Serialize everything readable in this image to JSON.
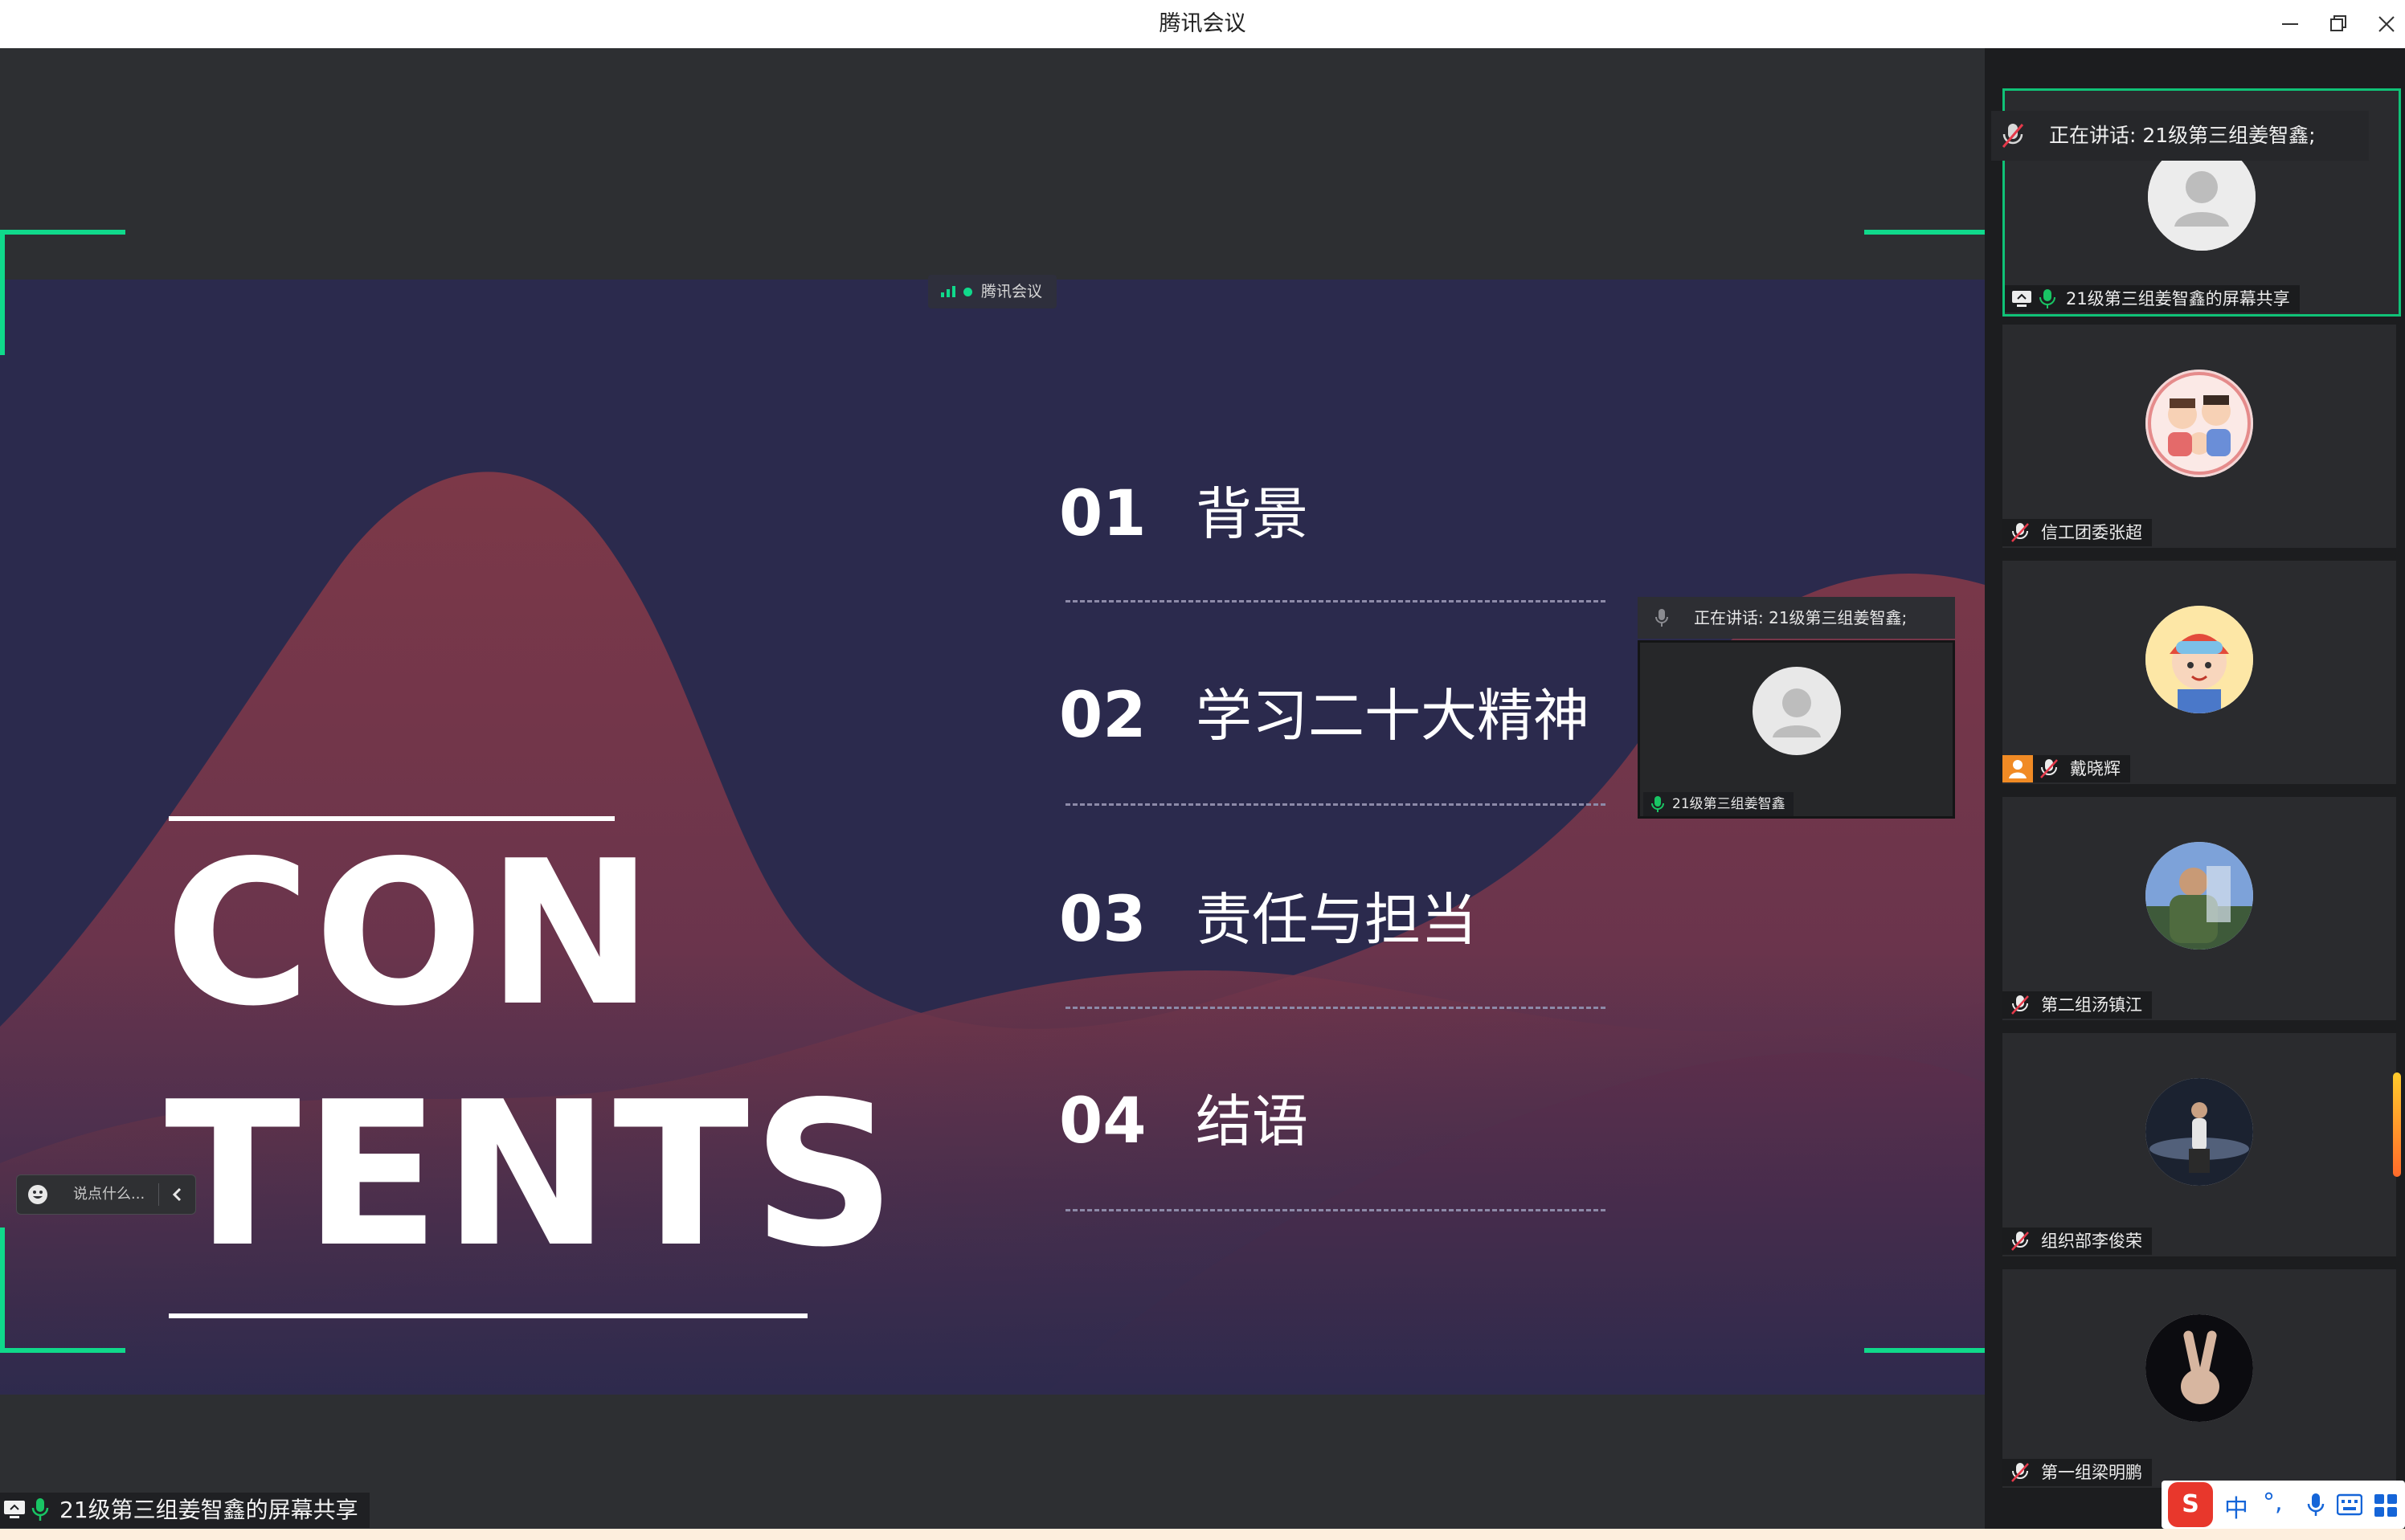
{
  "window": {
    "title": "腾讯会议"
  },
  "slide": {
    "tag": "腾讯会议",
    "contents_line1": "CON",
    "contents_line2": "TENTS",
    "toc": [
      {
        "num": "01",
        "text": "背景"
      },
      {
        "num": "02",
        "text": "学习二十大精神"
      },
      {
        "num": "03",
        "text": "责任与担当"
      },
      {
        "num": "04",
        "text": "结语"
      }
    ],
    "mini_speaking": "正在讲话: 21级第三组姜智鑫;",
    "mini_name": "21级第三组姜智鑫"
  },
  "chat": {
    "placeholder": "说点什么..."
  },
  "share_label": "21级第三组姜智鑫的屏幕共享",
  "panel": {
    "speaking": "正在讲话: 21级第三组姜智鑫;",
    "participants": [
      {
        "name": "21级第三组姜智鑫的屏幕共享",
        "avatar": "default-person"
      },
      {
        "name": "信工团委张超",
        "avatar": "cartoon-family"
      },
      {
        "name": "戴晓辉",
        "avatar": "cartoon-girl"
      },
      {
        "name": "第二组汤镇江",
        "avatar": "photo-person"
      },
      {
        "name": "组织部李俊荣",
        "avatar": "photo-figure"
      },
      {
        "name": "第一组梁明鹏",
        "avatar": "photo-peace-sign"
      }
    ]
  },
  "ime": {
    "logo": "S",
    "lang": "中",
    "punct": "°,",
    "icons": [
      "mic-icon",
      "keyboard-icon",
      "grid-icon"
    ]
  },
  "colors": {
    "accent": "#10d98b",
    "slide_bg": "#2b2a4d",
    "mountain": "#7d3a4a"
  }
}
